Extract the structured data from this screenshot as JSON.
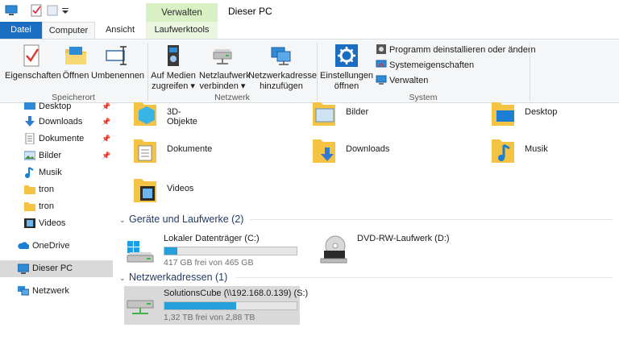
{
  "window": {
    "title": "Dieser PC",
    "context_tab": "Verwalten"
  },
  "tabs": [
    "Datei",
    "Computer",
    "Ansicht",
    "Laufwerktools"
  ],
  "ribbon": {
    "speicherort": {
      "label": "Speicherort",
      "buttons": [
        "Eigenschaften",
        "Öffnen",
        "Umbenennen"
      ]
    },
    "netzwerk": {
      "label": "Netzwerk",
      "buttons": [
        {
          "line1": "Auf Medien",
          "line2": "zugreifen ▾"
        },
        {
          "line1": "Netzlaufwerk",
          "line2": "verbinden ▾"
        },
        {
          "line1": "Netzwerkadresse",
          "line2": "hinzufügen"
        }
      ]
    },
    "system": {
      "label": "System",
      "settings": {
        "line1": "Einstellungen",
        "line2": "öffnen"
      },
      "small": [
        "Programm deinstallieren oder ändern",
        "Systemeigenschaften",
        "Verwalten"
      ]
    }
  },
  "sidebar": {
    "quick": [
      {
        "label": "Desktop",
        "icon": "desktop-icon",
        "pinned": true
      },
      {
        "label": "Downloads",
        "icon": "download-arrow-icon",
        "pinned": true
      },
      {
        "label": "Dokumente",
        "icon": "documents-icon",
        "pinned": true
      },
      {
        "label": "Bilder",
        "icon": "pictures-icon",
        "pinned": true
      },
      {
        "label": "Musik",
        "icon": "music-note-icon",
        "pinned": false
      },
      {
        "label": "tron",
        "icon": "folder-icon",
        "pinned": false
      },
      {
        "label": "tron",
        "icon": "folder-icon",
        "pinned": false
      },
      {
        "label": "Videos",
        "icon": "video-icon",
        "pinned": false
      }
    ],
    "onedrive": "OneDrive",
    "thispc": "Dieser PC",
    "network": "Netzwerk",
    "pin_glyph": "📌"
  },
  "folders": [
    "3D-Objekte",
    "Bilder",
    "Desktop",
    "Dokumente",
    "Downloads",
    "Musik",
    "Videos"
  ],
  "sections": {
    "devices": "Geräte und Laufwerke (2)",
    "network": "Netzwerkadressen (1)",
    "chevron": "⌄"
  },
  "drives": [
    {
      "name": "Lokaler Datenträger (C:)",
      "free": "417 GB frei von 465 GB",
      "used_fraction": 0.1
    },
    {
      "name": "DVD-RW-Laufwerk (D:)"
    }
  ],
  "network_drives": [
    {
      "name": "SolutionsCube (\\\\192.168.0.139) (S:)",
      "free": "1,32 TB frei von 2,88 TB",
      "used_fraction": 0.54
    }
  ],
  "colors": {
    "accent": "#1a6dc0",
    "context_tab": "#d9f0c4",
    "progress": "#26a0da",
    "selection": "#d9d9d9"
  }
}
